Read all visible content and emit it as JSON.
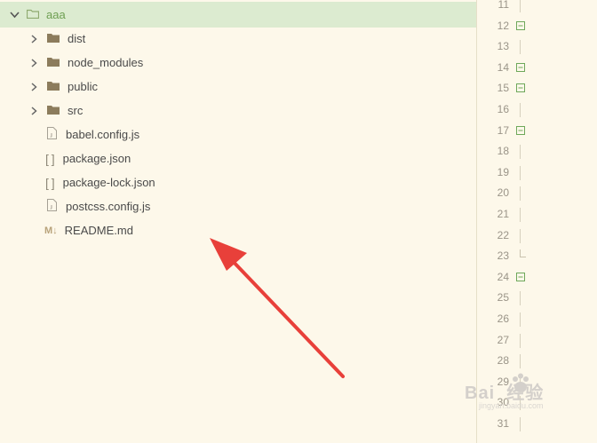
{
  "tree": {
    "root": {
      "label": "aaa",
      "icon": "folder-icon",
      "expanded": true
    },
    "folders": [
      {
        "label": "dist",
        "icon": "folder-icon"
      },
      {
        "label": "node_modules",
        "icon": "folder-icon"
      },
      {
        "label": "public",
        "icon": "folder-icon"
      },
      {
        "label": "src",
        "icon": "folder-icon"
      }
    ],
    "files": [
      {
        "label": "babel.config.js",
        "icon": "js-file-icon"
      },
      {
        "label": "package.json",
        "icon": "json-file-icon"
      },
      {
        "label": "package-lock.json",
        "icon": "json-file-icon"
      },
      {
        "label": "postcss.config.js",
        "icon": "js-file-icon"
      },
      {
        "label": "README.md",
        "icon": "markdown-file-icon",
        "badge": "M↓"
      }
    ]
  },
  "gutter": {
    "lines": [
      {
        "n": "11",
        "marker": "guide"
      },
      {
        "n": "12",
        "marker": "fold"
      },
      {
        "n": "13",
        "marker": "guide"
      },
      {
        "n": "14",
        "marker": "fold"
      },
      {
        "n": "15",
        "marker": "fold"
      },
      {
        "n": "16",
        "marker": "guide"
      },
      {
        "n": "17",
        "marker": "fold"
      },
      {
        "n": "18",
        "marker": "guide"
      },
      {
        "n": "19",
        "marker": "guide"
      },
      {
        "n": "20",
        "marker": "guide"
      },
      {
        "n": "21",
        "marker": "guide"
      },
      {
        "n": "22",
        "marker": "guide"
      },
      {
        "n": "23",
        "marker": "end"
      },
      {
        "n": "24",
        "marker": "fold"
      },
      {
        "n": "25",
        "marker": "guide"
      },
      {
        "n": "26",
        "marker": "guide"
      },
      {
        "n": "27",
        "marker": "guide"
      },
      {
        "n": "28",
        "marker": "guide"
      },
      {
        "n": "29",
        "marker": "guide"
      },
      {
        "n": "30",
        "marker": "guide"
      },
      {
        "n": "31",
        "marker": "guide"
      }
    ]
  },
  "annotation": {
    "color": "#e8403a"
  },
  "watermark": {
    "text": "Bai  经验",
    "sub": "jingyan.baidu.com"
  },
  "colors": {
    "folder": "#8c7c5c",
    "root_folder": "#8faa6f",
    "fold_marker": "#6ea85a"
  }
}
